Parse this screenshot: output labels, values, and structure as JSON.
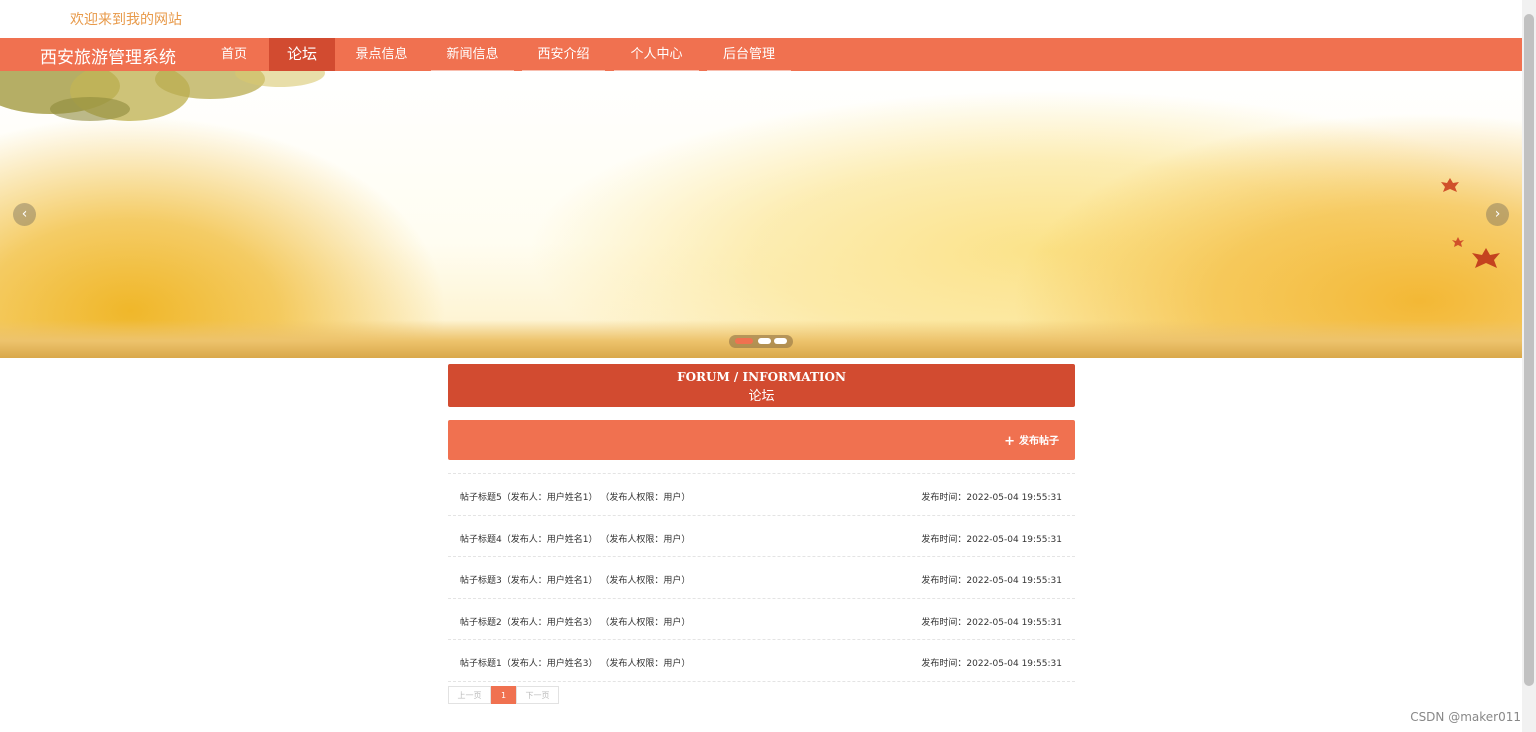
{
  "header": {
    "welcome": "欢迎来到我的网站"
  },
  "nav": {
    "brand": "西安旅游管理系统",
    "items": [
      {
        "label": "首页"
      },
      {
        "label": "论坛"
      },
      {
        "label": "景点信息"
      },
      {
        "label": "新闻信息"
      },
      {
        "label": "西安介绍"
      },
      {
        "label": "个人中心"
      },
      {
        "label": "后台管理"
      }
    ],
    "active_index": 1
  },
  "banner": {
    "prev_arrow": "‹",
    "next_arrow": "›",
    "slide_count": 3,
    "active_slide": 0
  },
  "section": {
    "title_en": "FORUM / INFORMATION",
    "title_cn": "论坛"
  },
  "actions": {
    "publish_icon": "+",
    "publish_label": "发布帖子"
  },
  "posts": [
    {
      "title": "帖子标题5（发布人：用户姓名1） （发布人权限：用户）",
      "time": "发布时间：2022-05-04 19:55:31"
    },
    {
      "title": "帖子标题4（发布人：用户姓名1） （发布人权限：用户）",
      "time": "发布时间：2022-05-04 19:55:31"
    },
    {
      "title": "帖子标题3（发布人：用户姓名1） （发布人权限：用户）",
      "time": "发布时间：2022-05-04 19:55:31"
    },
    {
      "title": "帖子标题2（发布人：用户姓名3） （发布人权限：用户）",
      "time": "发布时间：2022-05-04 19:55:31"
    },
    {
      "title": "帖子标题1（发布人：用户姓名3） （发布人权限：用户）",
      "time": "发布时间：2022-05-04 19:55:31"
    }
  ],
  "pager": {
    "prev": "上一页",
    "current": "1",
    "next": "下一页"
  },
  "watermark": "CSDN @maker011",
  "colors": {
    "primary": "#f07150",
    "primary_dark": "#d24b30",
    "welcome_text": "#e89a4a"
  }
}
